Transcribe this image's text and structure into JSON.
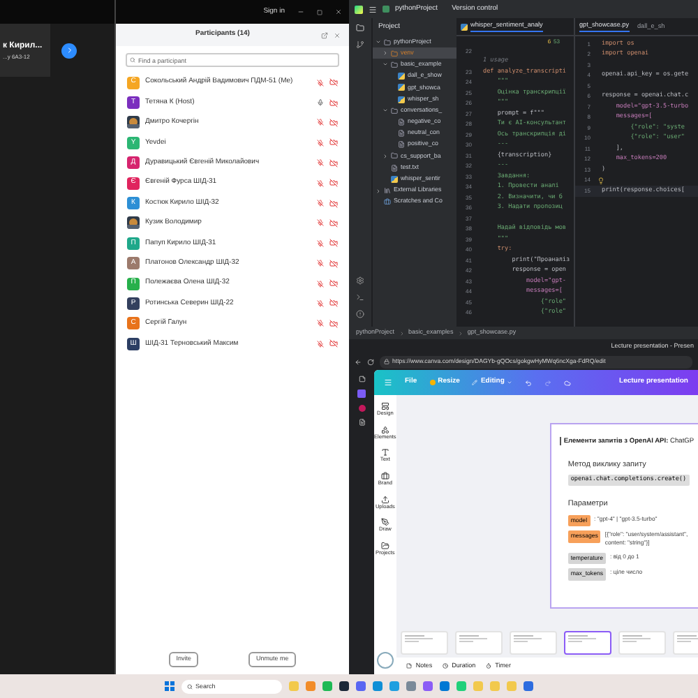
{
  "video_tile": {
    "name": "к Кирил...",
    "subtitle": "...у 6А3-12"
  },
  "participants_window": {
    "title_button": "Sign in",
    "title": "Participants (14)",
    "search": {
      "placeholder": "Find a participant"
    },
    "participants": [
      {
        "name": "Сокольський Андрій Вадимович ПДМ-51 (Me)",
        "avatar": {
          "kind": "letter",
          "letter": "С",
          "color": "#f5a623"
        },
        "mic_muted": true,
        "video_off": true
      },
      {
        "name": "Тетяна К (Host)",
        "avatar": {
          "kind": "letter",
          "letter": "Т",
          "color": "#7b2fbe"
        },
        "mic_muted": false,
        "video_off": true
      },
      {
        "name": "Дмитро Кочергін",
        "mic_muted": true,
        "video_off": true
      },
      {
        "name": "Yevdei",
        "avatar": {
          "kind": "letter",
          "letter": "Y",
          "color": "#2bb673"
        },
        "mic_muted": true,
        "video_off": true
      },
      {
        "name": "Дуравицький Євгеній Миколайович",
        "avatar": {
          "kind": "letter",
          "letter": "Д",
          "color": "#d6246e"
        },
        "mic_muted": true,
        "video_off": true
      },
      {
        "name": "Євгеній Фурса ШІД-31",
        "avatar": {
          "kind": "letter",
          "letter": "Є",
          "color": "#e0245e"
        },
        "mic_muted": true,
        "video_off": true
      },
      {
        "name": "Костюк Кирило ШІД-32",
        "avatar": {
          "kind": "letter",
          "letter": "К",
          "color": "#2d8fd5"
        },
        "mic_muted": true,
        "video_off": true
      },
      {
        "name": "Кузик Володимир",
        "mic_muted": true,
        "video_off": true
      },
      {
        "name": "Папуп Кирило ШІД-31",
        "avatar": {
          "kind": "letter",
          "letter": "П",
          "color": "#1fa88a"
        },
        "mic_muted": true,
        "video_off": true
      },
      {
        "name": "Платонов Олександр ШІД-32",
        "avatar": {
          "kind": "letter",
          "letter": "А",
          "color": "#9c7a6c"
        },
        "mic_muted": true,
        "video_off": true
      },
      {
        "name": "Полежаєва Олена ШІД-32",
        "avatar": {
          "kind": "letter",
          "letter": "П",
          "color": "#27b04b"
        },
        "mic_muted": true,
        "video_off": true
      },
      {
        "name": "Ротинська Северин ШІД-22",
        "avatar": {
          "kind": "letter",
          "letter": "Р",
          "color": "#33405e"
        },
        "mic_muted": true,
        "video_off": true
      },
      {
        "name": "Сергій Галун",
        "avatar": {
          "kind": "letter",
          "letter": "С",
          "color": "#e8731b"
        },
        "mic_muted": true,
        "video_off": true
      },
      {
        "name": "ШІД-31 Терновський Максим",
        "avatar": {
          "kind": "letter",
          "letter": "Ш",
          "color": "#2c3e63"
        },
        "mic_muted": true,
        "video_off": true
      }
    ],
    "buttons": [
      "Invite",
      "Unmute me"
    ]
  },
  "ide": {
    "project": "pythonProject",
    "vcs": "Version control",
    "panel_title": "Project",
    "tree": [
      {
        "label": "pythonProject",
        "kind": "folder",
        "selected": false,
        "expanded": true,
        "children": [
          {
            "label": "venv",
            "kind": "excluded",
            "selected": true,
            "expanded": false
          },
          {
            "label": "basic_example",
            "kind": "folder",
            "selected": false,
            "expanded": true,
            "children": [
              {
                "label": "dall_e_show",
                "kind": "py",
                "selected": false
              },
              {
                "label": "gpt_showca",
                "kind": "py",
                "selected": false
              },
              {
                "label": "whisper_sh",
                "kind": "py",
                "selected": false
              }
            ]
          },
          {
            "label": "conversations_",
            "kind": "folder",
            "selected": false,
            "expanded": true,
            "children": [
              {
                "label": "negative_co",
                "kind": "text",
                "selected": false
              },
              {
                "label": "neutral_con",
                "kind": "text",
                "selected": false
              },
              {
                "label": "positive_co",
                "kind": "text",
                "selected": false
              }
            ]
          },
          {
            "label": "cs_support_ba",
            "kind": "folder",
            "selected": false,
            "expanded": false
          },
          {
            "label": "test.txt",
            "kind": "text",
            "selected": false
          },
          {
            "label": "whisper_sentir",
            "kind": "py",
            "selected": false
          }
        ]
      },
      {
        "label": "External Libraries",
        "kind": "library",
        "selected": false,
        "expanded": false
      },
      {
        "label": "Scratches and Co",
        "kind": "scratch",
        "selected": false
      }
    ],
    "left_tab": "whisper_sentiment_analy",
    "inspection": "6",
    "inspection_ok": "53",
    "left_code": [
      {
        "n": "22",
        "kind": "plain"
      },
      {
        "text": "1 usage",
        "kind": "hint"
      },
      {
        "n": "23",
        "text": "def analyze_transcripti",
        "kind": "keyword"
      },
      {
        "n": "24",
        "text": "    \"\"\"",
        "kind": "string"
      },
      {
        "n": "25",
        "text": "    Оцінка транскрипції",
        "kind": "string"
      },
      {
        "n": "26",
        "text": "    \"\"\"",
        "kind": "string"
      },
      {
        "n": "27",
        "text": "    prompt = f\"\"\"",
        "kind": "plain"
      },
      {
        "n": "28",
        "text": "    Ти є AI-консультант",
        "kind": "string"
      },
      {
        "n": "29",
        "text": "    Ось транскрипція ді",
        "kind": "string"
      },
      {
        "n": "30",
        "text": "    ---",
        "kind": "string"
      },
      {
        "n": "31",
        "text": "    {transcription}",
        "kind": "plain"
      },
      {
        "n": "32",
        "text": "    ---",
        "kind": "string"
      },
      {
        "n": "33",
        "text": "    Завдання:",
        "kind": "string"
      },
      {
        "n": "34",
        "text": "    1. Провести аналі",
        "kind": "string"
      },
      {
        "n": "35",
        "text": "    2. Визначити, чи б",
        "kind": "string"
      },
      {
        "n": "36",
        "text": "    3. Надати пропозиц",
        "kind": "string"
      },
      {
        "n": "37",
        "kind": "plain"
      },
      {
        "n": "38",
        "text": "    Надай відповідь мов",
        "kind": "string"
      },
      {
        "n": "39",
        "text": "    \"\"\"",
        "kind": "string"
      },
      {
        "n": "40",
        "text": "    try:",
        "kind": "keyword"
      },
      {
        "n": "41",
        "text": "        print(\"Проаналіз",
        "kind": "plain"
      },
      {
        "n": "42",
        "text": "        response = open",
        "kind": "plain"
      },
      {
        "n": "43",
        "text": "            model=\"gpt-",
        "kind": "param"
      },
      {
        "n": "44",
        "text": "            messages=[",
        "kind": "param"
      },
      {
        "n": "45",
        "text": "                {\"role\"",
        "kind": "string"
      },
      {
        "n": "46",
        "text": "                {\"role\"",
        "kind": "string"
      }
    ],
    "right_tabs": [
      {
        "label": "gpt_showcase.py",
        "selected": true
      },
      {
        "label": "dall_e_sh",
        "selected": false
      }
    ],
    "right_code": [
      {
        "n": "1",
        "text": "import os",
        "kind": "keyword"
      },
      {
        "n": "2",
        "text": "import openai",
        "kind": "keyword"
      },
      {
        "n": "3",
        "kind": "plain"
      },
      {
        "n": "4",
        "text": "openai.api_key = os.gete",
        "kind": "plain"
      },
      {
        "n": "5",
        "kind": "plain"
      },
      {
        "n": "6",
        "text": "response = openai.chat.c",
        "kind": "plain"
      },
      {
        "n": "7",
        "text": "    model=\"gpt-3.5-turbo",
        "kind": "param"
      },
      {
        "n": "8",
        "text": "    messages=[",
        "kind": "param"
      },
      {
        "n": "9",
        "text": "        {\"role\": \"syste",
        "kind": "string"
      },
      {
        "n": "10",
        "text": "        {\"role\": \"user\"",
        "kind": "string"
      },
      {
        "n": "11",
        "text": "    ],",
        "kind": "plain"
      },
      {
        "n": "12",
        "text": "    max_tokens=200",
        "kind": "param"
      },
      {
        "n": "13",
        "text": ")",
        "kind": "plain"
      },
      {
        "n": "14",
        "kind": "bulb"
      },
      {
        "n": "15",
        "text": "print(response.choices[",
        "kind": "current"
      }
    ],
    "breadcrumbs": [
      "pythonProject",
      "basic_examples",
      "gpt_showcase.py"
    ]
  },
  "browser": {
    "tab_title": "Lecture presentation - Presen",
    "url": "https://www.canva.com/design/DAGYb-gQOcs/gokgwHyMWq6ncXga-FdRQ/edit",
    "toolbar": {
      "file": "File",
      "resize": "Resize",
      "editing": "Editing",
      "title": "Lecture presentation"
    },
    "side_items": [
      "Design",
      "Elements",
      "Text",
      "Brand",
      "Uploads",
      "Draw",
      "Projects"
    ],
    "slide": {
      "title_bold": "Елементи запитів з OpenAI API:",
      "title_rest": "ChatGP",
      "method_heading": "Метод виклику запиту",
      "method": "openai.chat.completions.create()",
      "params_heading": "Параметри",
      "params": [
        {
          "name": "model",
          "highlight": true,
          "desc": ": \"gpt-4\" | \"gpt-3.5-turbo\""
        },
        {
          "name": "messages",
          "highlight": true,
          "desc": "[{\"role\": \"user/system/assistant\", content: \"string\"}]"
        },
        {
          "name": "temperature",
          "highlight": false,
          "desc": ": від 0 до 1"
        },
        {
          "name": "max_tokens",
          "highlight": false,
          "desc": ": ціле число"
        }
      ]
    },
    "thumbnails": [
      {
        "selected": false
      },
      {
        "selected": false
      },
      {
        "selected": false
      },
      {
        "selected": true
      },
      {
        "selected": false
      },
      {
        "selected": false
      }
    ],
    "bottom": [
      "Notes",
      "Duration",
      "Timer"
    ]
  },
  "taskbar": {
    "search": {
      "placeholder": "Search"
    }
  }
}
